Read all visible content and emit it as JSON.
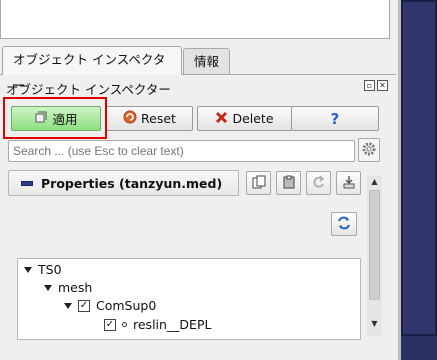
{
  "tabs": [
    {
      "label": "オブジェクト インスペクター",
      "active": true
    },
    {
      "label": "情報",
      "active": false
    }
  ],
  "dock": {
    "title": "オブジェクト インスペクター"
  },
  "toolbar": {
    "apply_label": "適用",
    "reset_label": "Reset",
    "delete_label": "Delete",
    "help_label": "?"
  },
  "search": {
    "placeholder": "Search ... (use Esc to clear text)"
  },
  "properties": {
    "title": "Properties (tanzyun.med)"
  },
  "tree": {
    "items": [
      {
        "label": "TS0",
        "expanded": true
      },
      {
        "label": "mesh",
        "expanded": true
      },
      {
        "label": "ComSup0",
        "checked": true
      },
      {
        "label": "reslin__DEPL",
        "checked": true
      }
    ]
  },
  "colors": {
    "apply": "#8ddf7f",
    "highlight": "#e00000",
    "side_panel": "#31376c"
  }
}
